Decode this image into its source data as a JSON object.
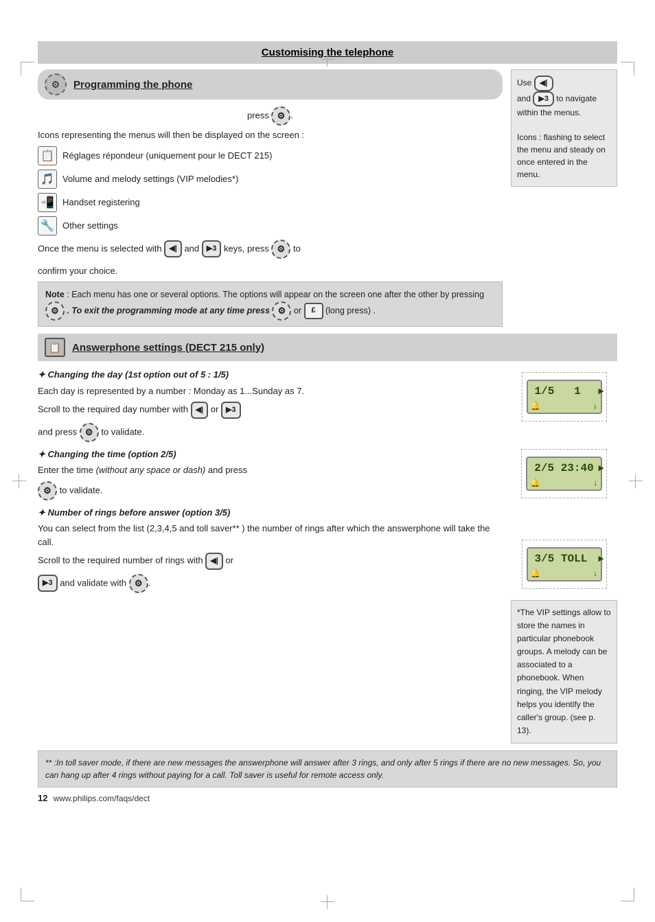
{
  "page": {
    "title": "Customising the telephone",
    "section1": {
      "header": "Programming the phone",
      "press_line": "press",
      "icons_intro": "Icons representing the menus will then be displayed on the screen :",
      "menu_items": [
        {
          "icon": "📻",
          "text": "Réglages répondeur (uniquement pour le DECT 215)"
        },
        {
          "icon": "🎵",
          "text": "Volume and melody settings (VIP melodies*)"
        },
        {
          "icon": "📱",
          "text": "Handset registering"
        },
        {
          "icon": "🔧",
          "text": "Other settings"
        }
      ],
      "confirm_text_1": "Once the menu is selected with",
      "confirm_text_and": "and",
      "confirm_text_2": "keys, press",
      "confirm_text_3": "to",
      "confirm_text_4": "confirm your choice.",
      "note": {
        "label": "Note",
        "text": ": Each menu has one or several options. The options will appear on the screen one after the other by pressing",
        "bold_part": ". To exit the programming mode at any time press",
        "or_text": "or",
        "end_text": "(long press) ."
      }
    },
    "sidebar1": {
      "use_text": "Use",
      "and_text": "and",
      "to_navigate": "to navigate within the menus.",
      "icons_note": "Icons : flashing to select the menu and steady on once entered in the menu."
    },
    "section2": {
      "header": "Answerphone settings (DECT 215 only)",
      "subsections": [
        {
          "title": "Changing the day (1st option out of 5 : 1/5)",
          "text1": "Each day is represented by a number : Monday as 1...Sunday as 7.",
          "text2": "Scroll to the required day number with",
          "or_text": "or",
          "text3": "and press",
          "text4": "to validate.",
          "lcd1": "1/5  1"
        },
        {
          "title": "Changing the time (option 2/5)",
          "text1": "Enter the time",
          "italic_part": "(without any space or dash)",
          "text2": "and press",
          "text3": "to validate.",
          "lcd2": "2/5  23:40"
        },
        {
          "title": "Number of rings before answer (option 3/5)",
          "text1": "You can select from the list (2,3,4,5 and toll saver** ) the number of rings after which the answerphone will take the call.",
          "text2": "Scroll to the required number of rings with",
          "or_text": "or",
          "text3": "and validate with",
          "lcd3": "3/5  TOLL"
        }
      ],
      "vip_sidebar": {
        "text": "*The VIP settings allow to store the names in particular phonebook groups. A melody can be associated to a phonebook. When ringing, the VIP melody helps you identify the caller's group. (see p. 13)."
      }
    },
    "footer": {
      "footnote": "** :In toll saver mode, if there are new messages the answerphone will answer after 3 rings, and only after 5 rings if there are no new messages. So, you can hang up after 4 rings without paying for a call. Toll saver is useful for remote access only.",
      "page_num": "12",
      "website": "www.philips.com/faqs/dect"
    }
  }
}
